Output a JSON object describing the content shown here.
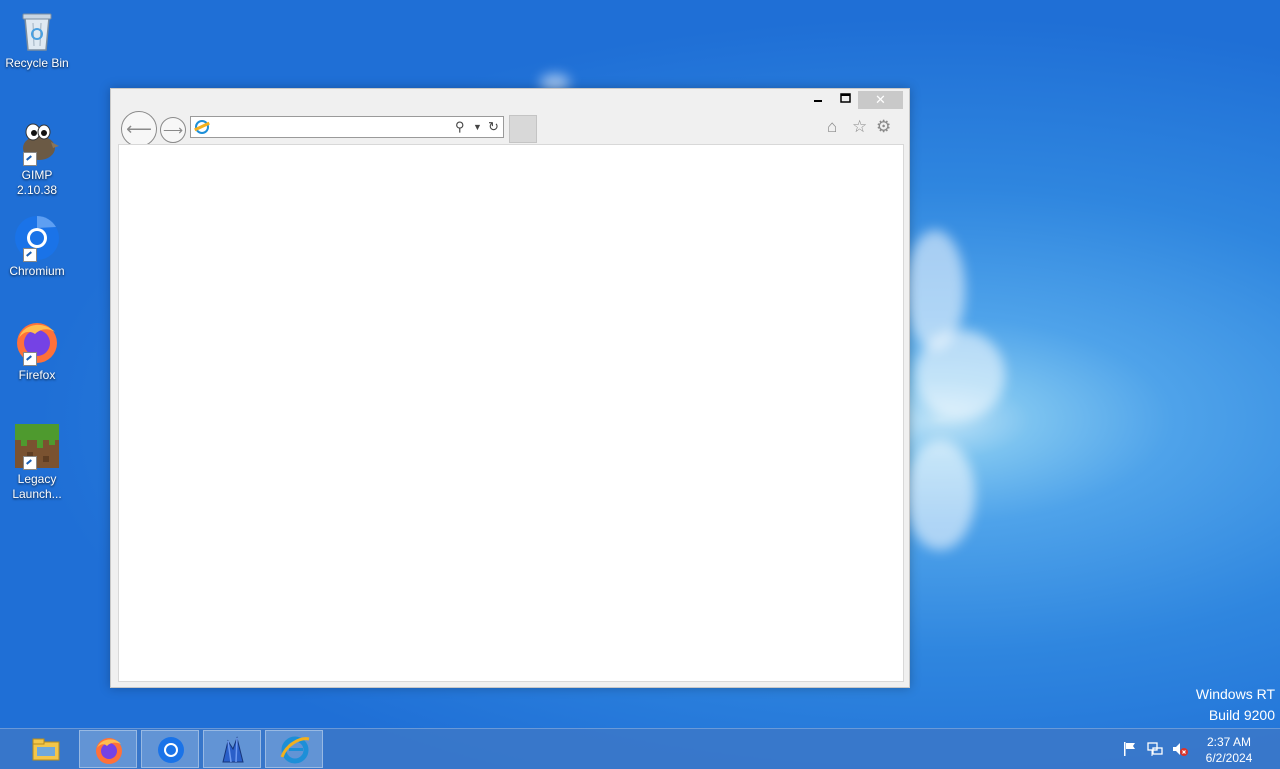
{
  "desktop": {
    "icons": [
      {
        "label": "Recycle Bin",
        "icon": "recycle-bin-icon"
      },
      {
        "label": "GIMP 2.10.38",
        "icon": "gimp-icon"
      },
      {
        "label": "Chromium",
        "icon": "chromium-icon"
      },
      {
        "label": "Firefox",
        "icon": "firefox-icon"
      },
      {
        "label": "Legacy Launch...",
        "icon": "minecraft-grass-block-icon"
      }
    ],
    "watermark": {
      "line1": "Windows RT",
      "line2": "Build 9200"
    }
  },
  "browser_window": {
    "app": "Internet Explorer",
    "address_value": "",
    "controls": {
      "minimize": "minimize-icon",
      "maximize": "maximize-icon",
      "close": "close-icon"
    },
    "toolbar_icons": [
      "home-icon",
      "favorites-star-icon",
      "tools-gear-icon"
    ]
  },
  "taskbar": {
    "buttons": [
      {
        "icon": "file-explorer-icon",
        "active": false
      },
      {
        "icon": "firefox-icon",
        "active": true
      },
      {
        "icon": "chromium-icon",
        "active": true
      },
      {
        "icon": "app-crystal-icon",
        "active": true
      },
      {
        "icon": "internet-explorer-icon",
        "active": true
      }
    ],
    "tray_icons": [
      "action-center-flag-icon",
      "network-icon",
      "volume-muted-icon"
    ],
    "clock": {
      "time": "2:37 AM",
      "date": "6/2/2024"
    }
  },
  "colors": {
    "desktop_bg": "#2f86df",
    "taskbar": "#3c78c8",
    "ie_blue": "#1d8fd8",
    "ie_gold": "#f2b01e"
  }
}
